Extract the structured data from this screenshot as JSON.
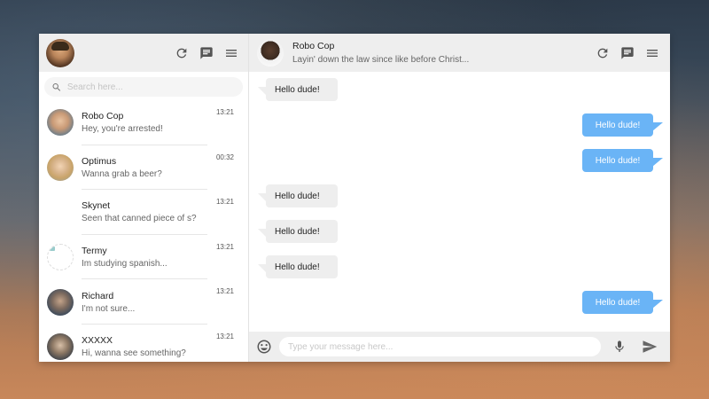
{
  "sidebar": {
    "search_placeholder": "Search here...",
    "contacts": [
      {
        "name": "Robo Cop",
        "preview": "Hey, you're arrested!",
        "time": "13:21"
      },
      {
        "name": "Optimus",
        "preview": "Wanna grab a beer?",
        "time": "00:32"
      },
      {
        "name": "Skynet",
        "preview": "Seen that canned piece of s?",
        "time": "13:21"
      },
      {
        "name": "Termy",
        "preview": "Im studying spanish...",
        "time": "13:21"
      },
      {
        "name": "Richard",
        "preview": "I'm not sure...",
        "time": "13:21"
      },
      {
        "name": "XXXXX",
        "preview": "Hi, wanna see something?",
        "time": "13:21"
      }
    ]
  },
  "chat": {
    "contact_name": "Robo Cop",
    "status": "Layin' down the law since like before Christ...",
    "messages": [
      {
        "direction": "in",
        "text": "Hello dude!"
      },
      {
        "direction": "out",
        "text": "Hello dude!"
      },
      {
        "direction": "out",
        "text": "Hello dude!"
      },
      {
        "direction": "in",
        "text": "Hello dude!"
      },
      {
        "direction": "in",
        "text": "Hello dude!"
      },
      {
        "direction": "in",
        "text": "Hello dude!"
      },
      {
        "direction": "out",
        "text": "Hello dude!"
      }
    ],
    "compose_placeholder": "Type your message here..."
  },
  "icons": {
    "refresh": "refresh-icon",
    "chat": "chat-icon",
    "menu": "menu-icon",
    "search": "search-icon",
    "emoji": "emoji-icon",
    "mic": "microphone-icon",
    "send": "send-icon"
  },
  "colors": {
    "outgoing_bubble": "#6ab4f6",
    "incoming_bubble": "#eeeeee",
    "header_bg": "#eeeeee"
  }
}
